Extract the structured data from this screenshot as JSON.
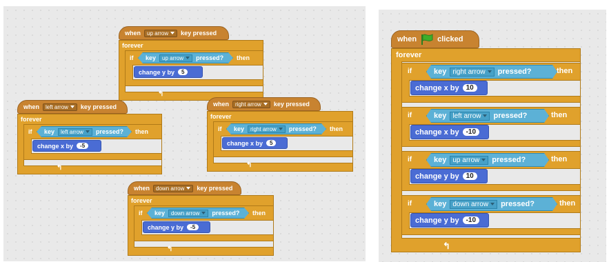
{
  "labels": {
    "when": "when",
    "key_pressed": "key pressed",
    "when_flag_clicked_suffix": "clicked",
    "forever": "forever",
    "if": "if",
    "key": "key",
    "pressed_q": "pressed?",
    "then": "then",
    "change_x_by": "change x by",
    "change_y_by": "change y by",
    "loop_arrow": "↰"
  },
  "left_scripts": [
    {
      "event_key": "up arrow",
      "if_key": "up arrow",
      "action": "change y by",
      "value": "5"
    },
    {
      "event_key": "left arrow",
      "if_key": "left arrow",
      "action": "change x by",
      "value": "-5"
    },
    {
      "event_key": "right arrow",
      "if_key": "right arrow",
      "action": "change x by",
      "value": "5"
    },
    {
      "event_key": "down arrow",
      "if_key": "down arrow",
      "action": "change y by",
      "value": "-5"
    }
  ],
  "right_script": {
    "conditions": [
      {
        "key": "right arrow",
        "action": "change x by",
        "value": "10"
      },
      {
        "key": "left arrow",
        "action": "change x by",
        "value": "-10"
      },
      {
        "key": "up arrow",
        "action": "change y by",
        "value": "10"
      },
      {
        "key": "down arrow",
        "action": "change y by",
        "value": "-10"
      }
    ]
  },
  "colors": {
    "events": "#c88330",
    "control": "#e0a12c",
    "sensing": "#5cb1d6",
    "motion": "#4a6cd4",
    "flag": "#3fae2a"
  }
}
